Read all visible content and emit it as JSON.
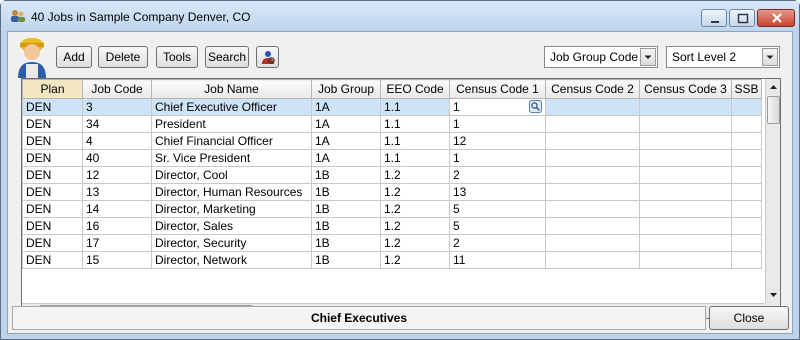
{
  "window": {
    "title": "40 Jobs in Sample Company Denver, CO"
  },
  "toolbar": {
    "add_label": "Add",
    "delete_label": "Delete",
    "tools_label": "Tools",
    "search_label": "Search",
    "permissions_icon": "user-lookup-icon"
  },
  "filters": {
    "group_select": "Job Group Code",
    "sort_select": "Sort Level 2"
  },
  "grid": {
    "columns": [
      "Plan",
      "Job Code",
      "Job Name",
      "Job Group",
      "EEO Code",
      "Census Code 1",
      "Census Code 2",
      "Census Code 3",
      "SSB"
    ],
    "rows": [
      {
        "plan": "DEN",
        "job_code": "3",
        "job_name": "Chief Executive Officer",
        "job_group": "1A",
        "eeo": "1.1",
        "census1": "1",
        "census2": "",
        "census3": ""
      },
      {
        "plan": "DEN",
        "job_code": "34",
        "job_name": "President",
        "job_group": "1A",
        "eeo": "1.1",
        "census1": "1",
        "census2": "",
        "census3": ""
      },
      {
        "plan": "DEN",
        "job_code": "4",
        "job_name": "Chief Financial Officer",
        "job_group": "1A",
        "eeo": "1.1",
        "census1": "12",
        "census2": "",
        "census3": ""
      },
      {
        "plan": "DEN",
        "job_code": "40",
        "job_name": "Sr. Vice President",
        "job_group": "1A",
        "eeo": "1.1",
        "census1": "1",
        "census2": "",
        "census3": ""
      },
      {
        "plan": "DEN",
        "job_code": "12",
        "job_name": "Director, Cool",
        "job_group": "1B",
        "eeo": "1.2",
        "census1": "2",
        "census2": "",
        "census3": ""
      },
      {
        "plan": "DEN",
        "job_code": "13",
        "job_name": "Director, Human Resources",
        "job_group": "1B",
        "eeo": "1.2",
        "census1": "13",
        "census2": "",
        "census3": ""
      },
      {
        "plan": "DEN",
        "job_code": "14",
        "job_name": "Director, Marketing",
        "job_group": "1B",
        "eeo": "1.2",
        "census1": "5",
        "census2": "",
        "census3": ""
      },
      {
        "plan": "DEN",
        "job_code": "16",
        "job_name": "Director, Sales",
        "job_group": "1B",
        "eeo": "1.2",
        "census1": "5",
        "census2": "",
        "census3": ""
      },
      {
        "plan": "DEN",
        "job_code": "17",
        "job_name": "Director, Security",
        "job_group": "1B",
        "eeo": "1.2",
        "census1": "2",
        "census2": "",
        "census3": ""
      },
      {
        "plan": "DEN",
        "job_code": "15",
        "job_name": "Director, Network",
        "job_group": "1B",
        "eeo": "1.2",
        "census1": "11",
        "census2": "",
        "census3": ""
      }
    ],
    "selected_row": 0
  },
  "status": {
    "text": "Chief Executives"
  },
  "footer": {
    "close_label": "Close"
  }
}
